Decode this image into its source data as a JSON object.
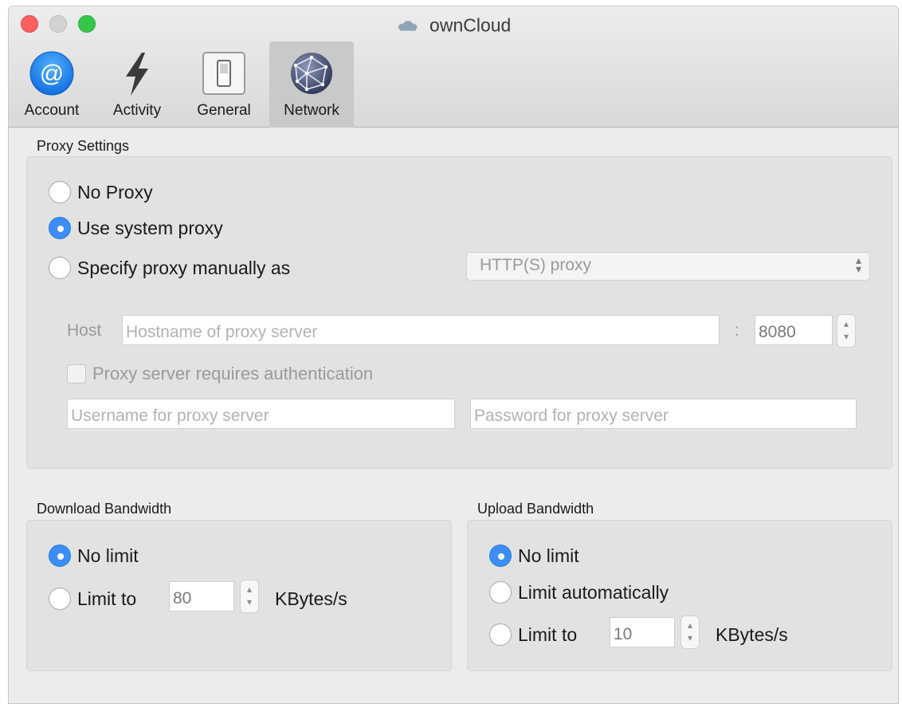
{
  "window": {
    "title": "ownCloud"
  },
  "tabs": [
    {
      "label": "Account",
      "icon": "at-sign-icon"
    },
    {
      "label": "Activity",
      "icon": "lightning-icon"
    },
    {
      "label": "General",
      "icon": "switch-icon"
    },
    {
      "label": "Network",
      "icon": "globe-icon",
      "active": true
    }
  ],
  "proxy": {
    "section_title": "Proxy Settings",
    "options": {
      "no_proxy": "No Proxy",
      "system_proxy": "Use system proxy",
      "manual": "Specify proxy manually as"
    },
    "selected": "system_proxy",
    "proxy_type": "HTTP(S) proxy",
    "host_label": "Host",
    "host_placeholder": "Hostname of proxy server",
    "port_separator": ":",
    "port_value": "8080",
    "auth_label": "Proxy server requires authentication",
    "username_placeholder": "Username for proxy server",
    "password_placeholder": "Password for proxy server"
  },
  "download": {
    "section_title": "Download Bandwidth",
    "no_limit": "No limit",
    "limit_to": "Limit to",
    "limit_value": "80",
    "unit": "KBytes/s",
    "selected": "no_limit"
  },
  "upload": {
    "section_title": "Upload Bandwidth",
    "no_limit": "No limit",
    "limit_auto": "Limit automatically",
    "limit_to": "Limit to",
    "limit_value": "10",
    "unit": "KBytes/s",
    "selected": "no_limit"
  },
  "colors": {
    "accent": "#3b8ef5",
    "close": "#fc605c",
    "maximize": "#34c84a"
  }
}
